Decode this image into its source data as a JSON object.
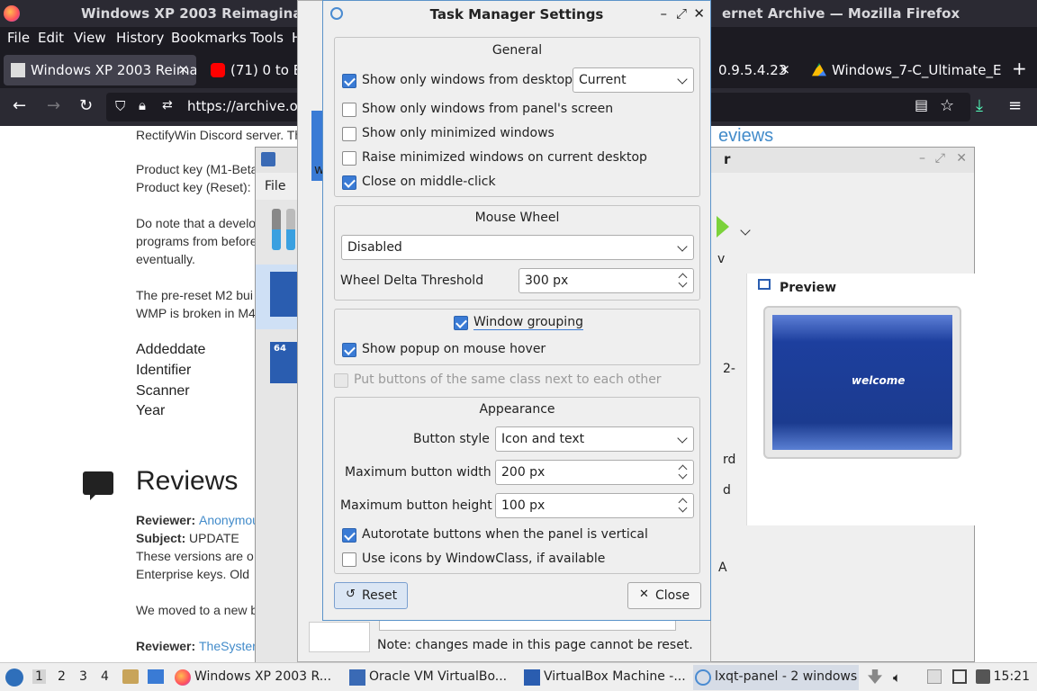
{
  "firefox": {
    "title_left": "Windows XP 2003 Reimagina",
    "title_right": "ernet Archive — Mozilla Firefox",
    "menu": [
      "File",
      "Edit",
      "View",
      "History",
      "Bookmarks",
      "Tools",
      "H"
    ],
    "tabs": [
      {
        "label": "Windows XP 2003 Reima",
        "close": "×"
      },
      {
        "label": "(71) 0 to Be",
        "close": ""
      },
      {
        "label": "0.9.5.4.23",
        "close": "×"
      },
      {
        "label": "Windows_7-C_Ultimate_E",
        "close": ""
      }
    ],
    "new_tab": "+",
    "url": "https://archive.or",
    "page": {
      "lines": [
        "RectifyWin Discord server. Th",
        "Product key (M1-Beta",
        "Product key (Reset):",
        "Do note that a develo",
        "programs from before",
        "eventually.",
        "The pre-reset M2 bui",
        "WMP is broken in M4"
      ],
      "meta": [
        "Addeddate",
        "Identifier",
        "Scanner",
        "Year"
      ],
      "reviews_heading": "Reviews",
      "reviews_right": "eviews",
      "reviewer_label": "Reviewer:",
      "reviewer_1": "Anonymou",
      "subject_label": "Subject:",
      "subject_1": "UPDATE",
      "review_text_1": "These versions are o",
      "review_text_2": "Enterprise keys. Old",
      "review_text_3": "We moved to a new b",
      "reviewer_2": "TheSyster"
    }
  },
  "vbox": {
    "menu_file": "File",
    "preview_title": "Preview",
    "welcome": "welcome",
    "note": "Note: changes made in this page cannot be reset.",
    "partial_right": [
      "2-",
      "rd",
      "d",
      "A"
    ],
    "partial_r_title": "r",
    "partial_w": "w",
    "partial_v": "v"
  },
  "dialog": {
    "title": "Task Manager Settings",
    "general": {
      "title": "General",
      "show_from_desktop": "Show only windows from desktop",
      "desktop_value": "Current",
      "show_from_panel": "Show only windows from panel's screen",
      "show_minimized": "Show only minimized windows",
      "raise_minimized": "Raise minimized windows on current desktop",
      "close_middle": "Close on middle-click"
    },
    "mouse_wheel": {
      "title": "Mouse Wheel",
      "mode": "Disabled",
      "threshold_label": "Wheel Delta Threshold",
      "threshold_value": "300 px"
    },
    "grouping": {
      "title": "Window grouping",
      "popup_hover": "Show popup on mouse hover"
    },
    "same_class": "Put buttons of the same class next to each other",
    "appearance": {
      "title": "Appearance",
      "button_style_label": "Button style",
      "button_style_value": "Icon and text",
      "max_width_label": "Maximum button width",
      "max_width_value": "200 px",
      "max_height_label": "Maximum button height",
      "max_height_value": "100 px",
      "autorotate": "Autorotate buttons when the panel is vertical",
      "use_icons": "Use icons by WindowClass, if available"
    },
    "reset_label": "Reset",
    "close_label": "Close"
  },
  "taskbar": {
    "workspaces": [
      "1",
      "2",
      "3",
      "4"
    ],
    "tasks": [
      "Windows XP 2003 R...",
      "Oracle VM VirtualBo...",
      "VirtualBox Machine -...",
      "lxqt-panel - 2 windows"
    ],
    "clock": "15:21"
  },
  "colors": {
    "accent": "#3a7bd5",
    "ff_dark": "#1c1b22",
    "link": "#428bca"
  }
}
